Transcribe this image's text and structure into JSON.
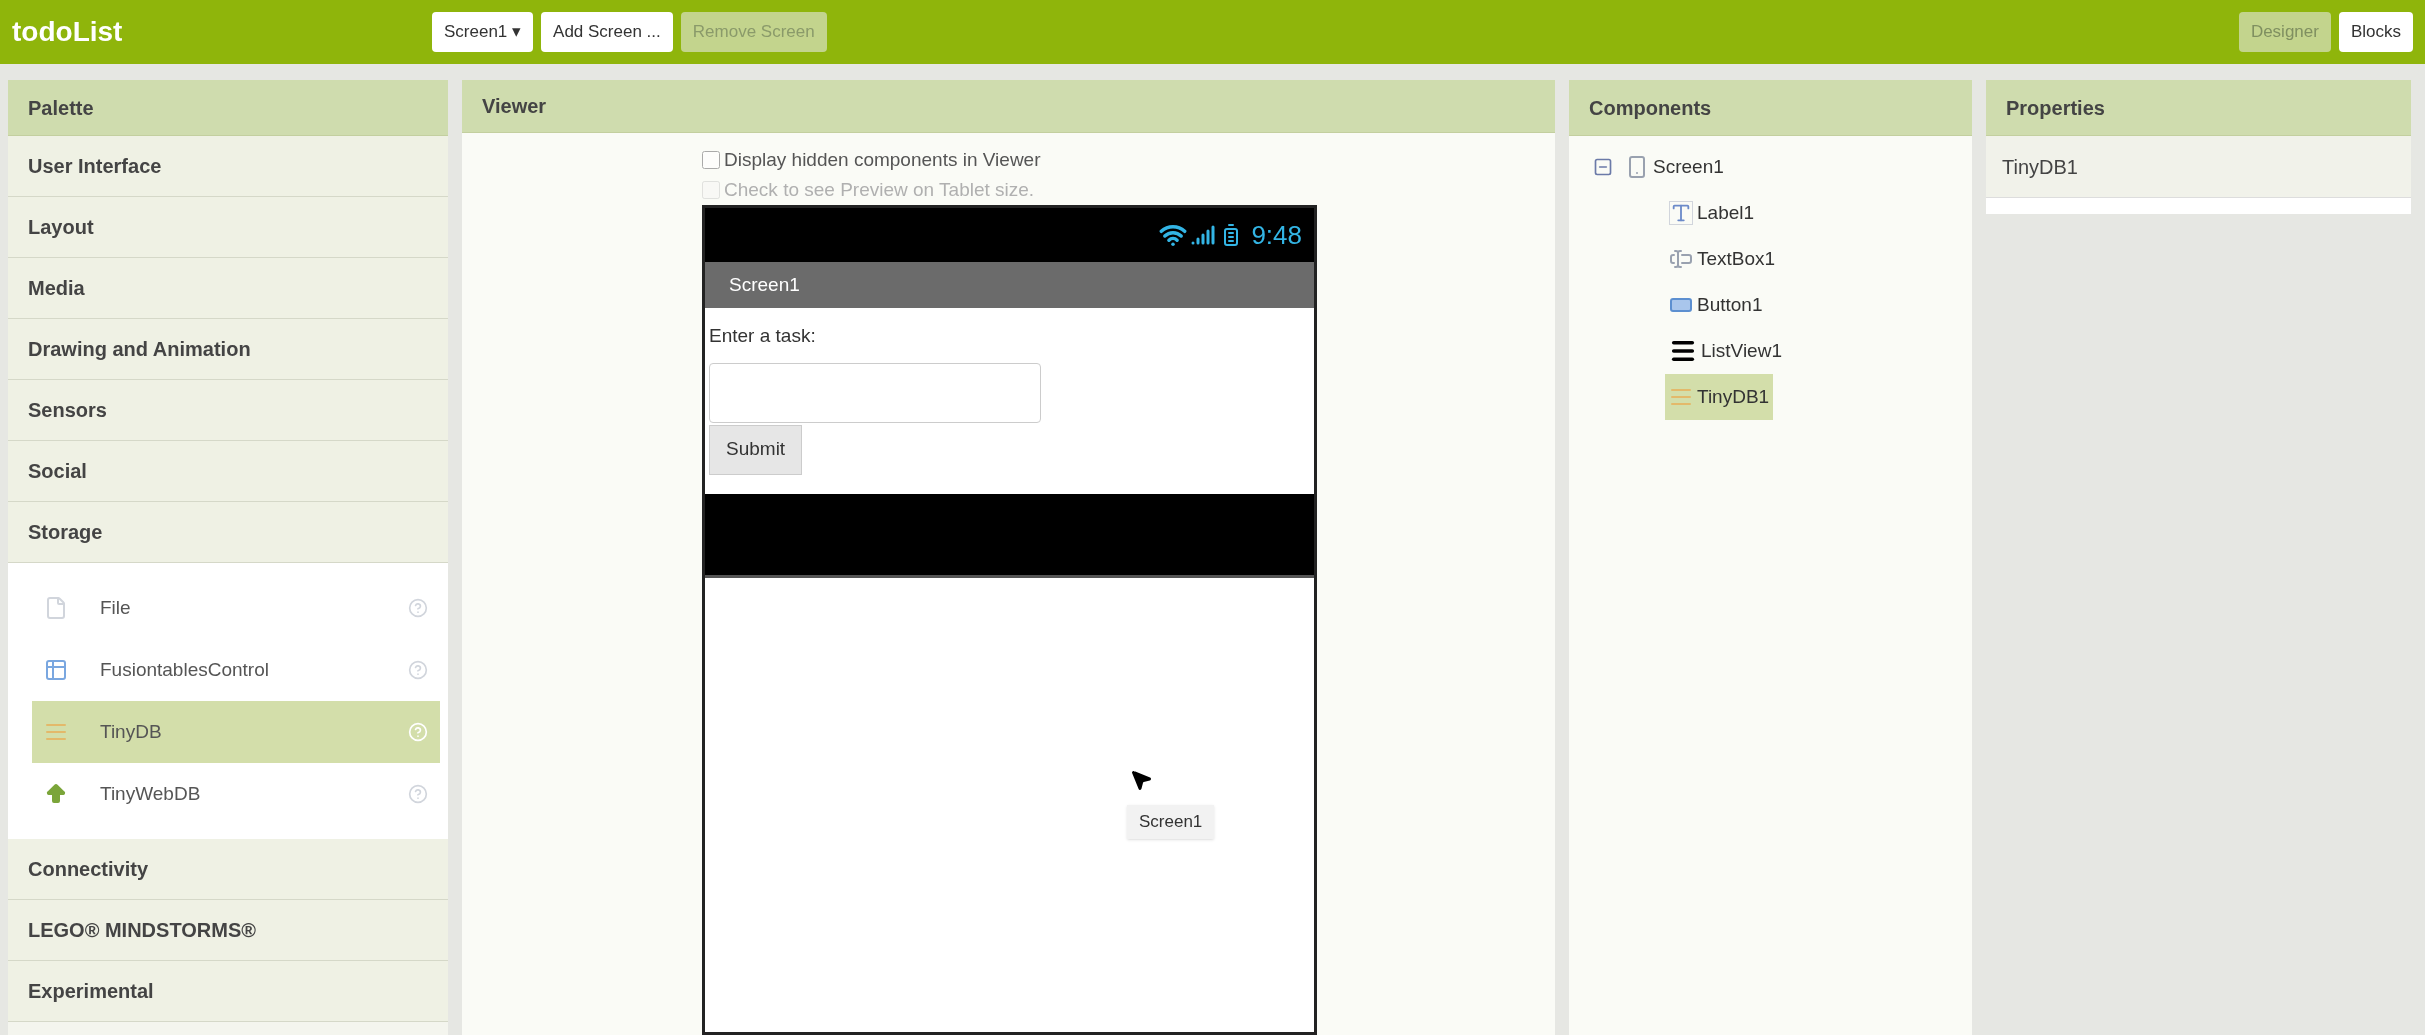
{
  "app_title": "todoList",
  "toolbar": [
    {
      "label": "Screen1 ▾",
      "disabled": false
    },
    {
      "label": "Add Screen ...",
      "disabled": false
    },
    {
      "label": "Remove Screen",
      "disabled": true
    }
  ],
  "view_switch": [
    {
      "label": "Designer",
      "selected": true
    },
    {
      "label": "Blocks",
      "selected": false
    }
  ],
  "palette": {
    "title": "Palette",
    "categories": [
      {
        "label": "User Interface"
      },
      {
        "label": "Layout"
      },
      {
        "label": "Media"
      },
      {
        "label": "Drawing and Animation"
      },
      {
        "label": "Sensors"
      },
      {
        "label": "Social"
      },
      {
        "label": "Storage",
        "items": [
          {
            "label": "File",
            "kind": "file",
            "selected": false
          },
          {
            "label": "FusiontablesControl",
            "kind": "fusiontables",
            "selected": false
          },
          {
            "label": "TinyDB",
            "kind": "tinydb",
            "selected": true
          },
          {
            "label": "TinyWebDB",
            "kind": "tinywebdb",
            "selected": false
          }
        ]
      },
      {
        "label": "Connectivity"
      },
      {
        "label": "LEGO® MINDSTORMS®"
      },
      {
        "label": "Experimental"
      }
    ]
  },
  "viewer": {
    "title": "Viewer",
    "options": [
      {
        "label": "Display hidden components in Viewer",
        "checked": false,
        "disabled": false
      },
      {
        "label": "Check to see Preview on Tablet size.",
        "checked": false,
        "disabled": true
      }
    ],
    "phone": {
      "time": "9:48",
      "screen_title": "Screen1",
      "label": "Enter a task:",
      "button": "Submit"
    },
    "tooltip": "Screen1"
  },
  "components": {
    "title": "Components",
    "tree": [
      {
        "label": "Screen1",
        "kind": "screen",
        "expanded": true,
        "selected": false,
        "children": [
          {
            "label": "Label1",
            "kind": "label",
            "selected": false
          },
          {
            "label": "TextBox1",
            "kind": "textbox",
            "selected": false
          },
          {
            "label": "Button1",
            "kind": "button",
            "selected": false
          },
          {
            "label": "ListView1",
            "kind": "listview",
            "selected": false
          },
          {
            "label": "TinyDB1",
            "kind": "tinydb",
            "selected": true
          }
        ]
      }
    ]
  },
  "properties": {
    "title": "Properties",
    "component": "TinyDB1"
  }
}
